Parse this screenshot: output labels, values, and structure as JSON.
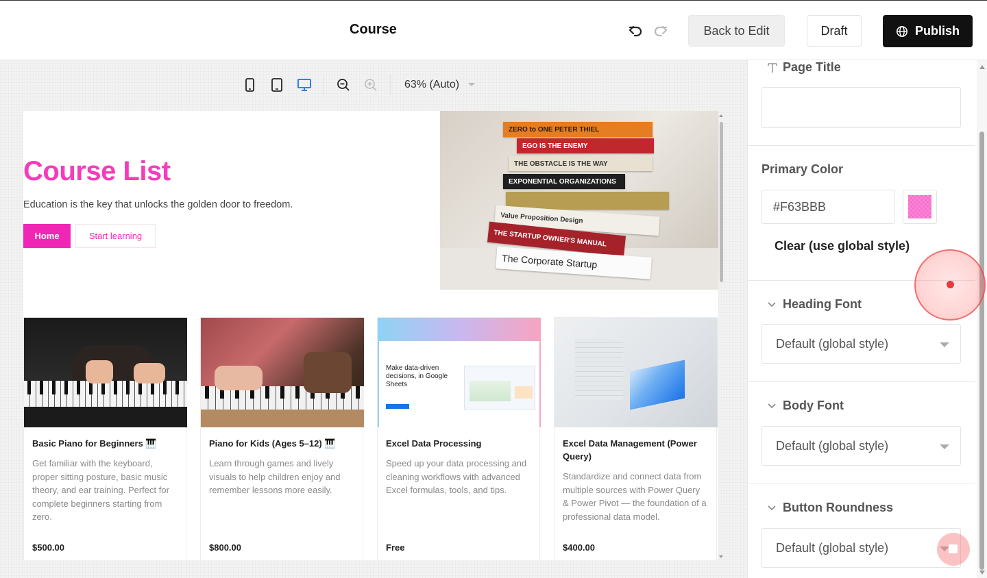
{
  "header": {
    "title": "Course",
    "back_label": "Back to Edit",
    "draft_label": "Draft",
    "publish_label": "Publish"
  },
  "viewbar": {
    "zoom": "63% (Auto)"
  },
  "preview": {
    "hero_title": "Course List",
    "hero_subtitle": "Education is the key that unlocks the golden door to freedom.",
    "home_label": "Home",
    "start_label": "Start learning",
    "books": [
      "ZERO to ONE   PETER THIEL",
      "EGO IS THE ENEMY",
      "THE OBSTACLE IS THE WAY",
      "EXPONENTIAL ORGANIZATIONS",
      "Value Proposition Design",
      "THE STARTUP OWNER'S MANUAL",
      "The Corporate Startup"
    ],
    "cards": [
      {
        "title": "Basic Piano for Beginners 🎹",
        "desc": "Get familiar with the keyboard, proper sitting posture, basic music theory, and ear training. Perfect for complete beginners starting from zero.",
        "price": "$500.00"
      },
      {
        "title": "Piano for Kids (Ages 5–12) 🎹",
        "desc": "Learn through games and lively visuals to help children enjoy and remember lessons more easily.",
        "price": "$800.00"
      },
      {
        "title": "Excel Data Processing",
        "desc": "Speed up your data processing and cleaning workflows with advanced Excel formulas, tools, and tips.",
        "price": "Free",
        "img_text": "Make data-driven decisions, in Google Sheets"
      },
      {
        "title": "Excel Data Management (Power Query)",
        "desc": "Standardize and connect data from multiple sources with Power Query & Power Pivot — the foundation of a professional data model.",
        "price": "$400.00"
      }
    ]
  },
  "panel": {
    "page_title_label": "Page Title",
    "page_title_value": "",
    "primary_color_label": "Primary Color",
    "primary_color_value": "#F63BBB",
    "clear_label": "Clear (use global style)",
    "heading_font_label": "Heading Font",
    "heading_font_value": "Default (global style)",
    "body_font_label": "Body Font",
    "body_font_value": "Default (global style)",
    "button_roundness_label": "Button Roundness",
    "button_roundness_value": "Default (global style)"
  },
  "colors": {
    "primary": "#F63BBB",
    "button": "#F027B5",
    "publish_bg": "#111111",
    "accent_blue": "#1a73e8"
  }
}
